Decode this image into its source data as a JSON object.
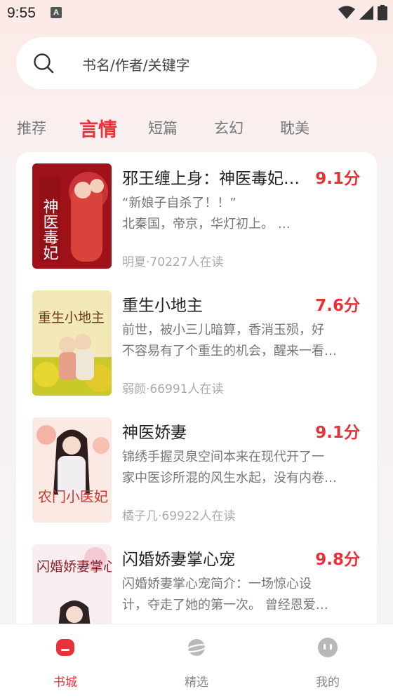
{
  "status_bar": {
    "time": "9:55",
    "a_icon": "A"
  },
  "search": {
    "placeholder": "书名/作者/关键字"
  },
  "tabs": [
    {
      "label": "推荐",
      "active": false
    },
    {
      "label": "言情",
      "active": true
    },
    {
      "label": "短篇",
      "active": false
    },
    {
      "label": "玄幻",
      "active": false
    },
    {
      "label": "耽美",
      "active": false
    }
  ],
  "books": [
    {
      "title": "邪王缠上身：神医毒妃…",
      "score": "9.1分",
      "desc_line1": "“新娘子自杀了！！”",
      "desc_line2": "北秦国，帝京，华灯初上。 …",
      "meta": "明夏·70227人在读",
      "cover_text": "神医毒妃"
    },
    {
      "title": "重生小地主",
      "score": "7.6分",
      "desc_line1": "前世，被小三儿暗算，香消玉殒，好",
      "desc_line2": "不容易有了个重生的机会，醒来一看…",
      "meta": "弱颜·66991人在读",
      "cover_text": "重生小地主"
    },
    {
      "title": "神医娇妻",
      "score": "9.1分",
      "desc_line1": "锦绣手握灵泉空间本来在现代开了一",
      "desc_line2": "家中医诊所混的风生水起，没有内卷…",
      "meta": "橘子几·69922人在读",
      "cover_text": "农门小医妃"
    },
    {
      "title": "闪婚娇妻掌心宠",
      "score": "9.8分",
      "desc_line1": "闪婚娇妻掌心宠简介：一场惊心设",
      "desc_line2": "计，夺走了她的第一次。 曾经恩爱…",
      "meta": "",
      "cover_text": "闪婚娇妻掌心宠"
    }
  ],
  "bottom_nav": [
    {
      "label": "书城",
      "active": true,
      "icon": "bookstore-icon"
    },
    {
      "label": "精选",
      "active": false,
      "icon": "planet-icon"
    },
    {
      "label": "我的",
      "active": false,
      "icon": "profile-face-icon"
    }
  ],
  "colors": {
    "accent": "#e8323a",
    "text": "#222222",
    "muted": "#777777"
  }
}
